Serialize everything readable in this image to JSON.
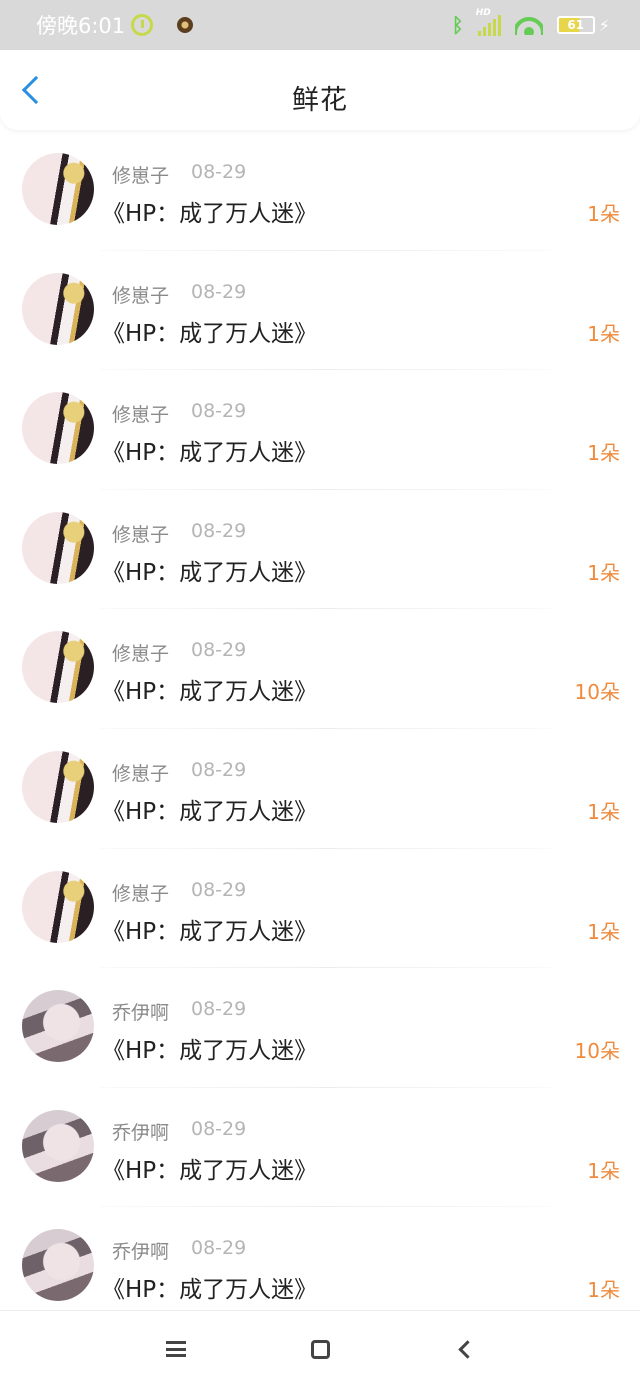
{
  "status_bar": {
    "time": "傍晚6:01",
    "battery_level": "61",
    "network_label": "HD",
    "icons": [
      "alarm-icon",
      "app-icon",
      "bluetooth-icon",
      "signal-icon",
      "wifi-icon",
      "battery-icon",
      "charging-icon"
    ]
  },
  "header": {
    "title": "鲜花",
    "back_icon": "chevron-left-icon",
    "accent_color": "#2a8fe0"
  },
  "list": {
    "count_color": "#f08a3c",
    "items": [
      {
        "name": "修崽子",
        "date": "08-29",
        "book": "《HP：成了万人迷》",
        "count": "1朵",
        "avatar": "avatar-1"
      },
      {
        "name": "修崽子",
        "date": "08-29",
        "book": "《HP：成了万人迷》",
        "count": "1朵",
        "avatar": "avatar-1"
      },
      {
        "name": "修崽子",
        "date": "08-29",
        "book": "《HP：成了万人迷》",
        "count": "1朵",
        "avatar": "avatar-1"
      },
      {
        "name": "修崽子",
        "date": "08-29",
        "book": "《HP：成了万人迷》",
        "count": "1朵",
        "avatar": "avatar-1"
      },
      {
        "name": "修崽子",
        "date": "08-29",
        "book": "《HP：成了万人迷》",
        "count": "10朵",
        "avatar": "avatar-1"
      },
      {
        "name": "修崽子",
        "date": "08-29",
        "book": "《HP：成了万人迷》",
        "count": "1朵",
        "avatar": "avatar-1"
      },
      {
        "name": "修崽子",
        "date": "08-29",
        "book": "《HP：成了万人迷》",
        "count": "1朵",
        "avatar": "avatar-1"
      },
      {
        "name": "乔伊啊",
        "date": "08-29",
        "book": "《HP：成了万人迷》",
        "count": "10朵",
        "avatar": "avatar-2"
      },
      {
        "name": "乔伊啊",
        "date": "08-29",
        "book": "《HP：成了万人迷》",
        "count": "1朵",
        "avatar": "avatar-2"
      },
      {
        "name": "乔伊啊",
        "date": "08-29",
        "book": "《HP：成了万人迷》",
        "count": "1朵",
        "avatar": "avatar-2"
      }
    ]
  },
  "nav_bar": {
    "icons": [
      "menu-icon",
      "home-icon",
      "back-icon"
    ]
  }
}
